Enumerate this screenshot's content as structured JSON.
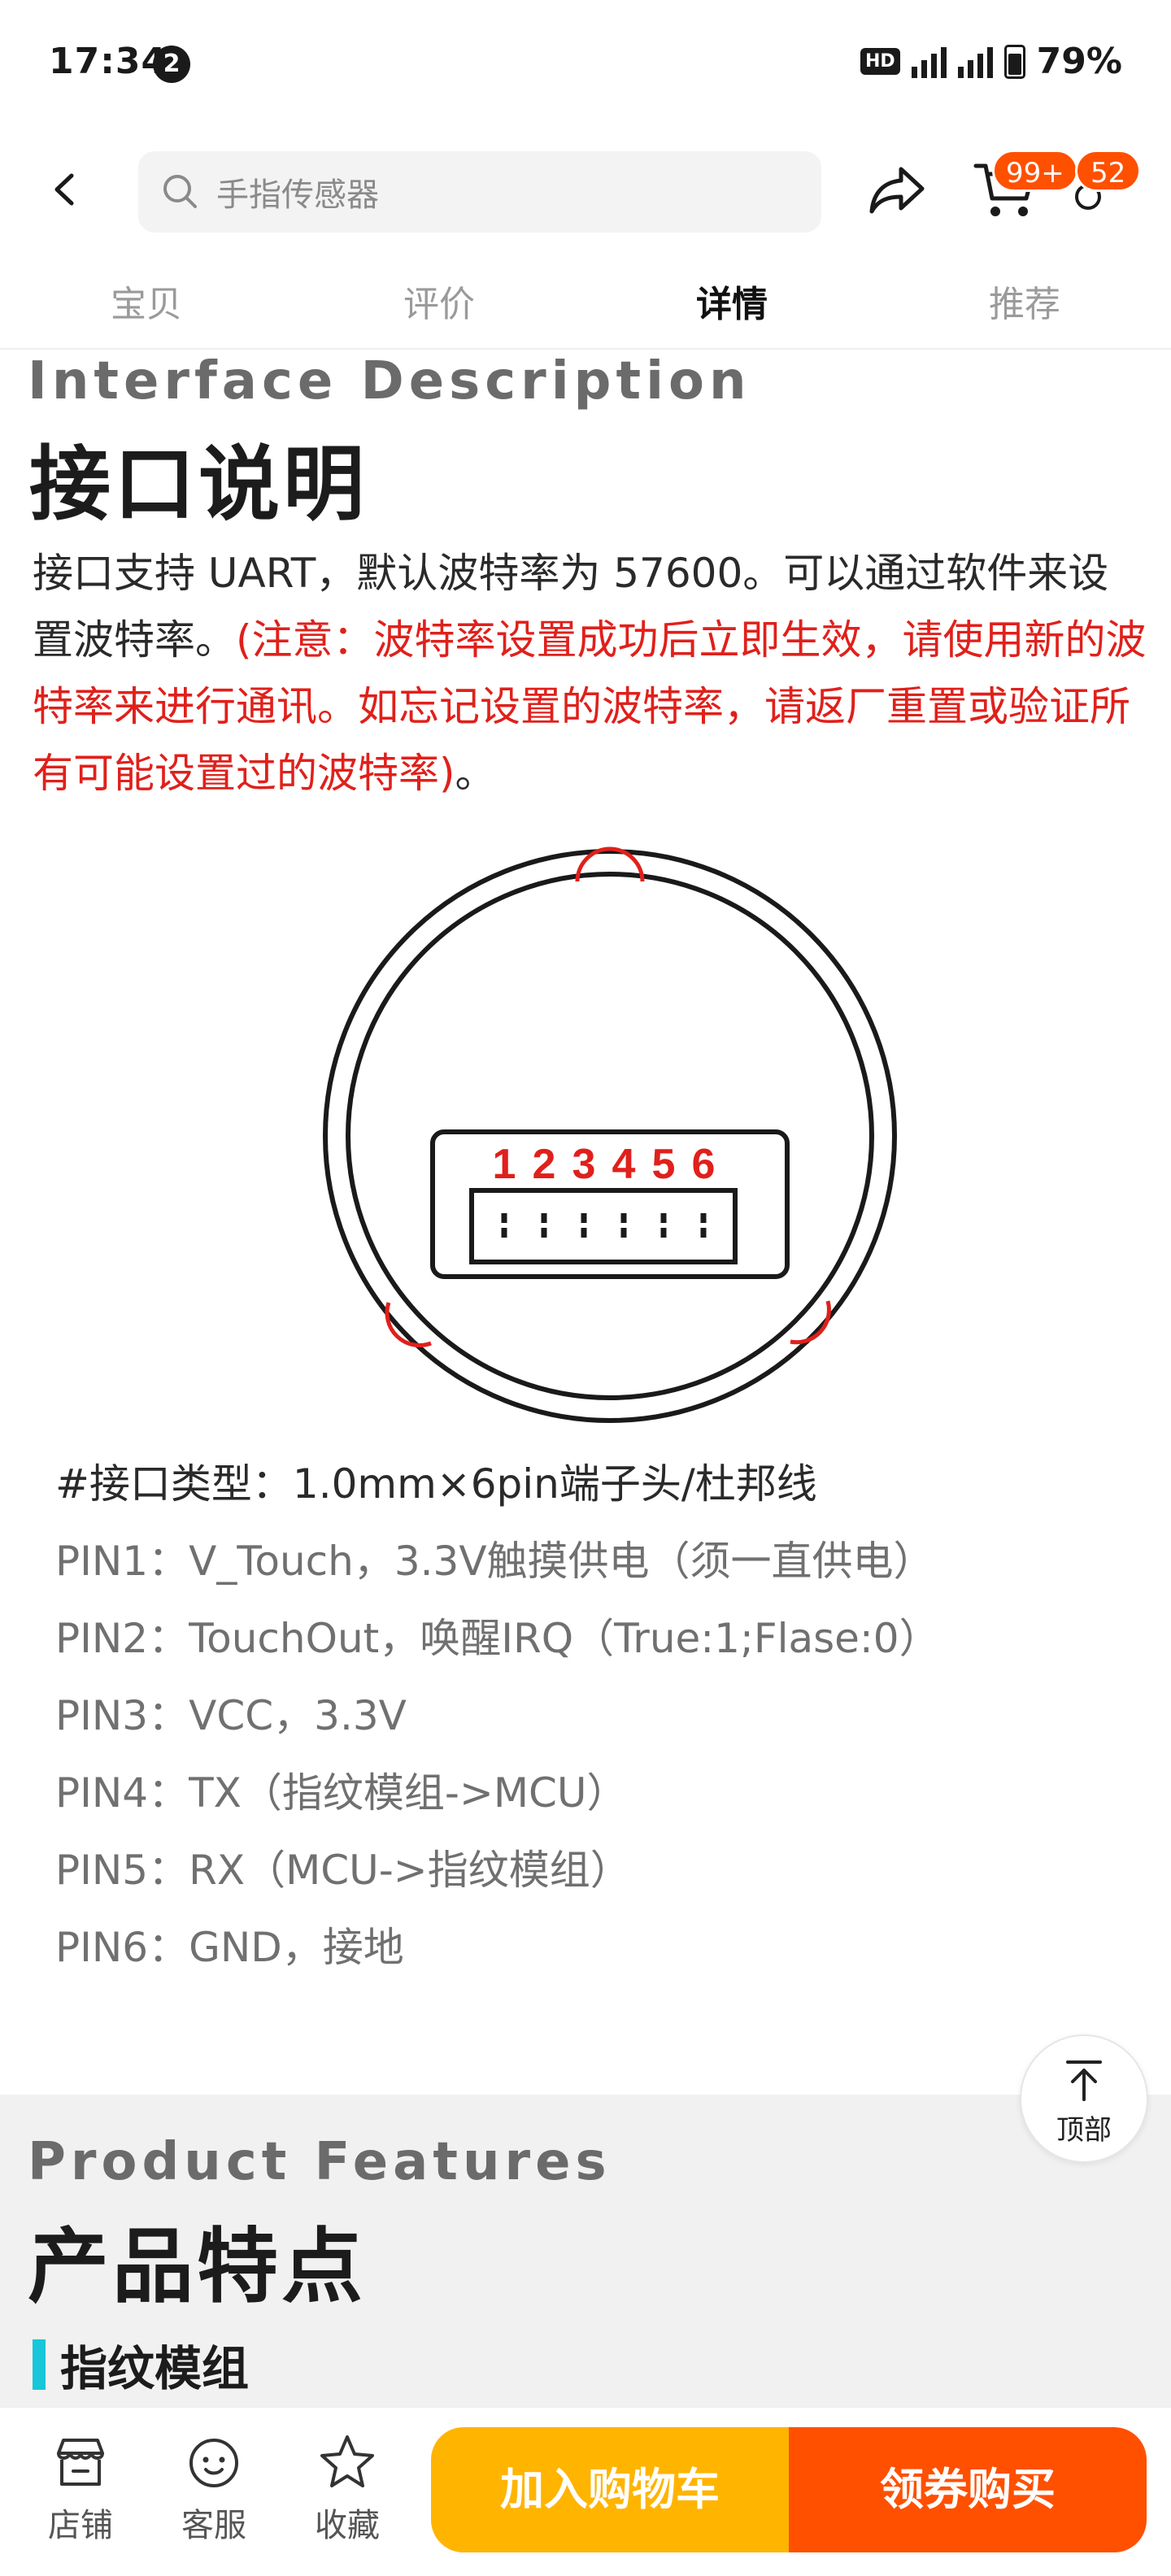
{
  "status_bar": {
    "time": "17:34",
    "notification_count": "2",
    "hd_label": "HD",
    "network_1": "5G",
    "network_2": "5G",
    "battery": "79%"
  },
  "header": {
    "search_placeholder": "手指传感器",
    "cart_badge": "99+",
    "message_badge": "52"
  },
  "tabs": [
    {
      "label": "宝贝",
      "active": false
    },
    {
      "label": "评价",
      "active": false
    },
    {
      "label": "详情",
      "active": true
    },
    {
      "label": "推荐",
      "active": false
    }
  ],
  "interface": {
    "en_title": "Interface Description",
    "cn_title": "接口说明",
    "description": "接口支持 UART，默认波特率为 57600。可以通过软件来设置波特率。",
    "note": "(注意：波特率设置成功后立即生效，请使用新的波特率来进行通讯。如忘记设置的波特率，请返厂重置或验证所有可能设置过的波特率)",
    "note_end": "。",
    "diagram_pin_numbers": [
      "1",
      "2",
      "3",
      "4",
      "5",
      "6"
    ],
    "pins": [
      "#接口类型：1.0mm×6pin端子头/杜邦线",
      "PIN1：V_Touch，3.3V触摸供电（须一直供电）",
      "PIN2：TouchOut，唤醒IRQ（True:1;Flase:0）",
      "PIN3：VCC，3.3V",
      "PIN4：TX（指纹模组->MCU）",
      "PIN5：RX（MCU->指纹模组）",
      "PIN6：GND，接地"
    ]
  },
  "back_to_top": {
    "label": "顶部"
  },
  "features": {
    "en_title": "Product Features",
    "cn_title": "产品特点",
    "subheading": "指纹模组"
  },
  "bottom_bar": {
    "shop": "店铺",
    "service": "客服",
    "favorite": "收藏",
    "add_to_cart": "加入购物车",
    "buy_with_coupon": "领券购买"
  },
  "colors": {
    "accent_orange": "#ff5000",
    "accent_yellow": "#ffb400",
    "note_red": "#e0201b",
    "feature_bar_cyan": "#17c6d8"
  }
}
